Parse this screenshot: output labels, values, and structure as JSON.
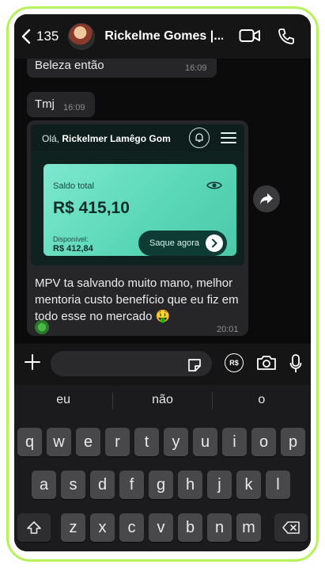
{
  "header": {
    "back_count": "135",
    "contact_name": "Rickelme Gomes |..."
  },
  "messages": [
    {
      "text": "Beleza então",
      "time": "16:09"
    },
    {
      "text": "Tmj",
      "time": "16:09"
    }
  ],
  "image_message": {
    "app": {
      "greeting_prefix": "Olá,",
      "greeting_name": "Rickelmer Lamêgo Gom",
      "saldo_label": "Saldo total",
      "saldo_value": "R$ 415,10",
      "disponivel_label": "Disponível:",
      "disponivel_value": "R$ 412,84",
      "saque_label": "Saque agora"
    },
    "caption": "MPV ta salvando muito mano, melhor mentoria custo benefício que eu fiz em todo esse no mercado 🤑",
    "time": "20:01"
  },
  "input": {
    "placeholder": "",
    "currency_icon_label": "R$"
  },
  "keyboard": {
    "suggestions": [
      "eu",
      "não",
      "o"
    ],
    "row1": [
      "q",
      "w",
      "e",
      "r",
      "t",
      "y",
      "u",
      "i",
      "o",
      "p"
    ],
    "row2": [
      "a",
      "s",
      "d",
      "f",
      "g",
      "h",
      "j",
      "k",
      "l"
    ],
    "row3": [
      "z",
      "x",
      "c",
      "v",
      "b",
      "n",
      "m"
    ]
  },
  "colors": {
    "frame_border": "#b6f25a",
    "bubble_bg": "#262628",
    "balance_card": "#58d6b6",
    "saque_button": "#0e3b34"
  },
  "icons": [
    "chevron-left-icon",
    "video-call-icon",
    "phone-icon",
    "bell-icon",
    "menu-icon",
    "eye-icon",
    "chevron-right-icon",
    "share-icon",
    "plus-icon",
    "sticker-icon",
    "currency-icon",
    "camera-icon",
    "microphone-icon",
    "shift-icon",
    "backspace-icon"
  ]
}
